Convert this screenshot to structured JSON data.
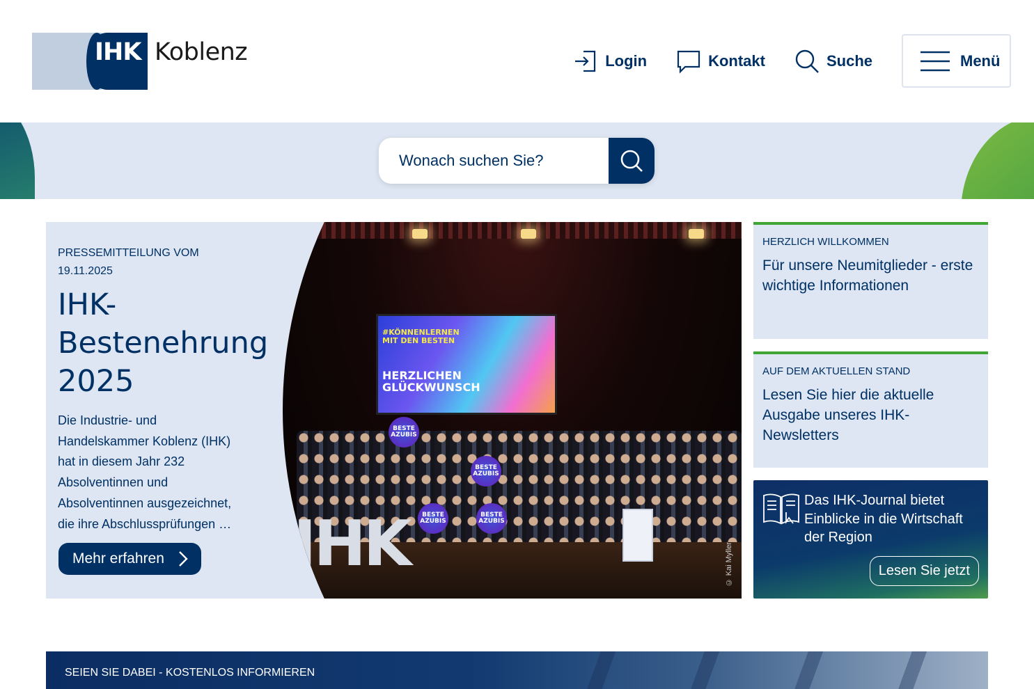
{
  "header": {
    "logo": {
      "mark": "IHK",
      "city": "Koblenz"
    },
    "nav": {
      "login": "Login",
      "kontakt": "Kontakt",
      "suche": "Suche",
      "menu": "Menü"
    }
  },
  "search": {
    "placeholder": "Wonach suchen Sie?"
  },
  "hero": {
    "kicker": "PRESSEMITTEILUNG VOM 19.11.2025",
    "title": "IHK-Bestenehrung 2025",
    "description": "Die Industrie- und Handelskammer Koblenz (IHK) hat in diesem Jahr 232 Absolventinnen und Absolventinnen ausgezeichnet, die ihre Abschlussprüfungen …",
    "button": "Mehr erfahren",
    "photo": {
      "screen_tag_line1": "#KÖNNENLERNEN",
      "screen_tag_line2": "MIT DEN BESTEN",
      "screen_message_line1": "HERZLICHEN",
      "screen_message_line2": "GLÜCKWUNSCH",
      "badge_text": "BESTE AZUBIS",
      "stage_letters": "IHK",
      "credit": "© Kai Myller"
    }
  },
  "cards": [
    {
      "kicker": "HERZLICH WILLKOMMEN",
      "title": "Für unsere Neumitglieder - erste wichtige Informationen"
    },
    {
      "kicker": "AUF DEM AKTUELLEN STAND",
      "title": "Lesen Sie hier die aktuelle Ausgabe unseres IHK-Newsletters"
    }
  ],
  "journal": {
    "text": "Das IHK-Journal bietet Einblicke in die Wirtschaft der Region",
    "button": "Lesen Sie jetzt",
    "icon": "open-book-icon"
  },
  "teaser": {
    "label": "SEIEN SIE DABEI - KOSTENLOS INFORMIEREN"
  },
  "colors": {
    "brand_dark": "#003064",
    "brand_light": "#dde6f2",
    "accent_green": "#3fa535"
  }
}
